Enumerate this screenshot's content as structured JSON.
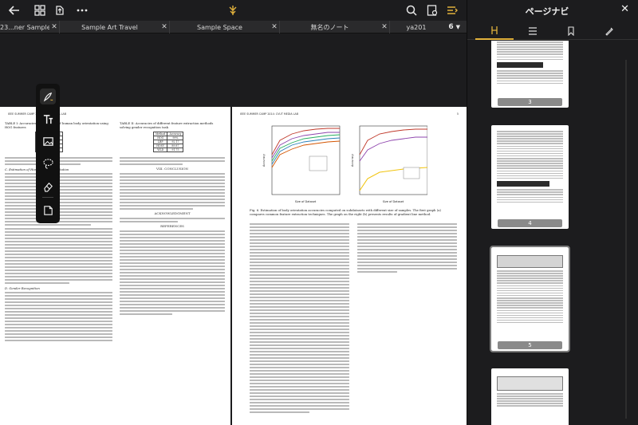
{
  "toolbar": {
    "back_icon": "arrow-left-icon",
    "grid_icon": "grid-icon",
    "share_icon": "share-icon",
    "more_icon": "ellipsis-icon",
    "app_logo": "app-logo-icon",
    "search_icon": "search-icon",
    "page_settings_icon": "page-settings-icon",
    "outline_icon": "outline-icon"
  },
  "tabs": [
    {
      "label": "23...ner Sample"
    },
    {
      "label": "Sample Art Travel"
    },
    {
      "label": "Sample Space"
    },
    {
      "label": "無名のノート"
    },
    {
      "label": "ya201"
    }
  ],
  "tab_count": "6",
  "palette": {
    "items": [
      "pen-icon",
      "text-icon",
      "image-icon",
      "lasso-icon",
      "eraser-icon",
      "shape-icon"
    ]
  },
  "left_page": {
    "header": "IEEE SUMMER CAMP 2014: CVUT MEDIA LAB",
    "section1": "C. Estimation of Human Body Orientation",
    "section2": "D. Gender Recognition",
    "table_title": "TABLE I: Accuracies of estimation of human body orientation using HOG features",
    "table_rows": [
      [
        "1",
        "5",
        "Accuracy"
      ],
      [
        "2",
        "4",
        "91.17"
      ],
      [
        "3",
        "5",
        "91.37"
      ],
      [
        "4",
        "4",
        "96.89"
      ],
      [
        "5",
        "4",
        "95.77"
      ]
    ]
  },
  "mid_page": {
    "table_title": "TABLE II: Accuracies of different feature extraction methods solving gender recognition task",
    "table_rows": [
      [
        "Method",
        "Accuracy"
      ],
      [
        "HOG",
        "99%"
      ],
      [
        "LBP",
        "92.17"
      ],
      [
        "HOSV",
        "89.87"
      ],
      [
        "WLD",
        "91.75"
      ]
    ],
    "section_conclusion": "VIII. CONCLUSION",
    "section_ack": "ACKNOWLEDGMENT",
    "section_refs": "REFERENCES"
  },
  "right_page": {
    "header_left": "IEEE SUMMER CAMP 2014: CVUT MEDIA LAB",
    "header_right": "5",
    "fig_xlabel": "Size of Dataset",
    "fig_ylabel": "Accuracy",
    "fig_caption": "Fig. 6. Estimation of body orientation accuracies computed on subdatasets with different size of samples. The first graph (a) compares common feature extraction techniques. The graph on the right (b) presents results of gradient line method."
  },
  "sidepanel": {
    "title": "ページナビ",
    "close_icon": "close-icon",
    "tab_icons": [
      "bookmark-h-icon",
      "list-icon",
      "bookmark-icon",
      "pen-tool-icon"
    ],
    "thumbs": [
      {
        "label": "3"
      },
      {
        "label": "4"
      },
      {
        "label": "5"
      },
      {
        "label": ""
      }
    ]
  },
  "colors": {
    "accent": "#e2b23c",
    "background": "#1c1c1e",
    "tabbar": "#2a2a2c"
  }
}
